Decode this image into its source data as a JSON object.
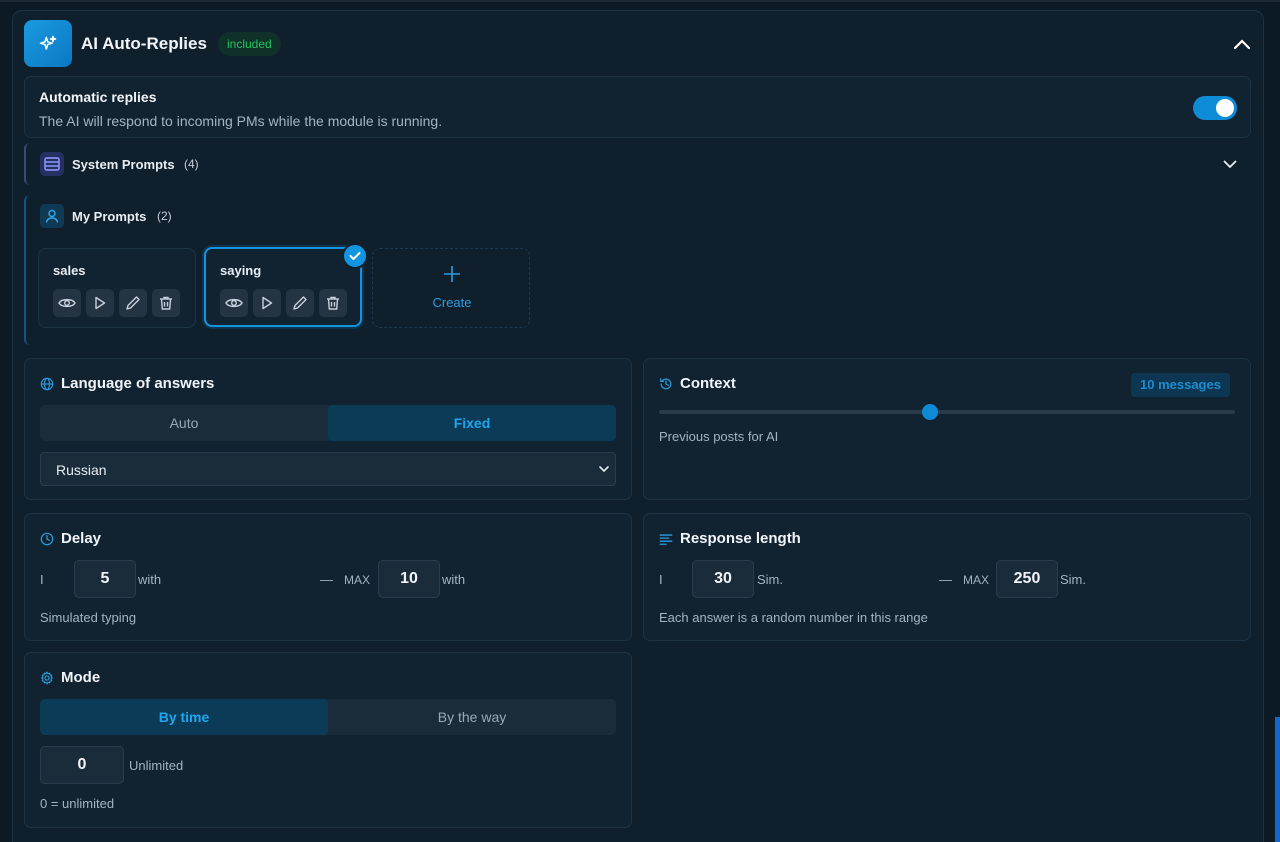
{
  "header": {
    "title": "AI Auto-Replies",
    "badge": "included"
  },
  "auto_replies": {
    "title": "Automatic replies",
    "description": "The AI will respond to incoming PMs while the module is running.",
    "enabled": true
  },
  "system_prompts": {
    "label": "System Prompts",
    "count": "(4)"
  },
  "my_prompts": {
    "label": "My Prompts",
    "count": "(2)",
    "items": [
      {
        "name": "sales",
        "selected": false
      },
      {
        "name": "saying",
        "selected": true
      }
    ],
    "create_label": "Create"
  },
  "language": {
    "title": "Language of answers",
    "options": [
      "Auto",
      "Fixed"
    ],
    "active": "Fixed",
    "selected_language": "Russian"
  },
  "context": {
    "title": "Context",
    "badge": "10 messages",
    "slider_fraction": 0.47,
    "description": "Previous posts for AI"
  },
  "delay": {
    "title": "Delay",
    "min_prefix": "I",
    "min_value": "5",
    "min_unit": "with",
    "dash": "—",
    "max_label": "MAX",
    "max_value": "10",
    "max_unit": "with",
    "description": "Simulated typing"
  },
  "response_length": {
    "title": "Response length",
    "min_prefix": "I",
    "min_value": "30",
    "min_unit": "Sim.",
    "dash": "—",
    "max_label": "MAX",
    "max_value": "250",
    "max_unit": "Sim.",
    "description": "Each answer is a random number in this range"
  },
  "mode": {
    "title": "Mode",
    "options": [
      "By time",
      "By the way"
    ],
    "active": "By time",
    "value": "0",
    "value_label": "Unlimited",
    "description": "0 = unlimited"
  },
  "colors": {
    "accent": "#0e8bd6",
    "success": "#22c55e",
    "background": "#0c1a26"
  }
}
